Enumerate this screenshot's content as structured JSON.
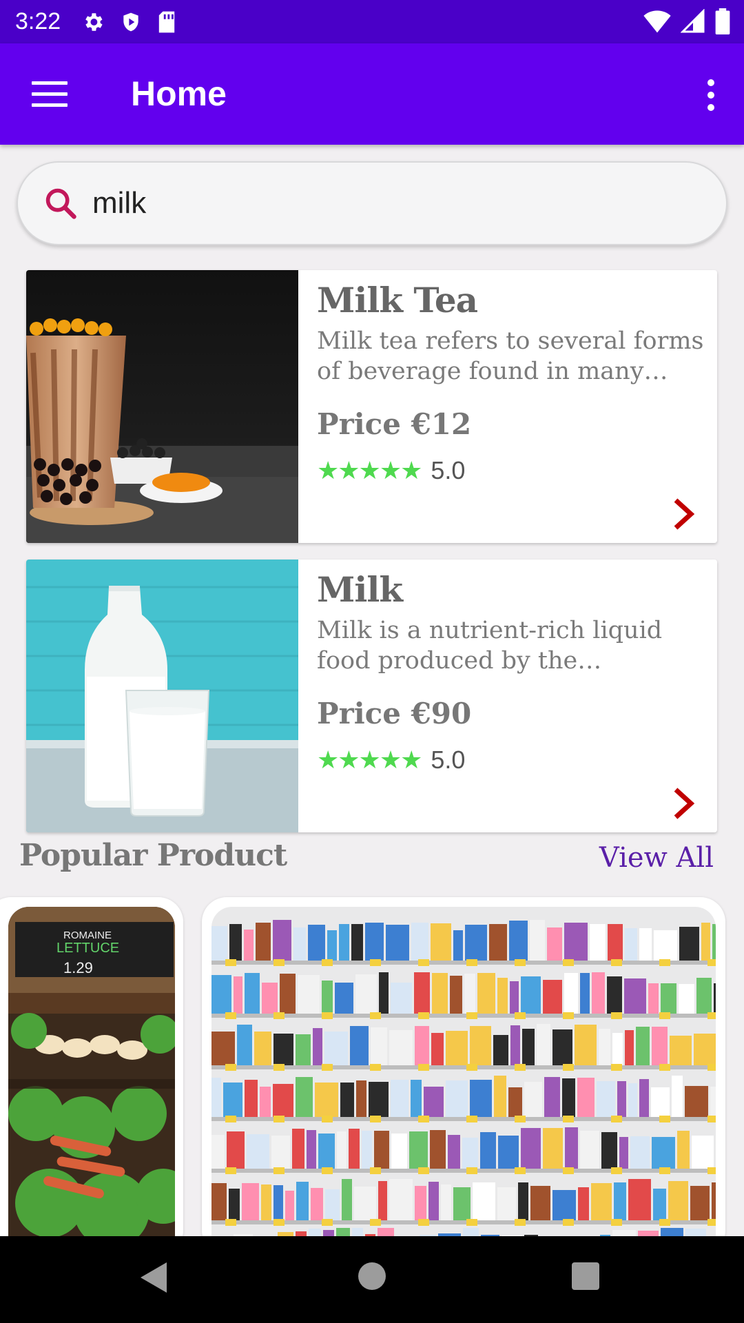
{
  "status_bar": {
    "time": "3:22",
    "icons_left": [
      "settings-icon",
      "shield-icon",
      "sd-card-icon"
    ],
    "icons_right": [
      "wifi-icon",
      "signal-icon",
      "battery-icon"
    ]
  },
  "app_bar": {
    "title": "Home",
    "color": "#6200ee"
  },
  "search": {
    "value": "milk",
    "placeholder": ""
  },
  "results": [
    {
      "title": "Milk Tea",
      "description": "Milk tea refers to several forms of beverage found in many cult…",
      "price": "Price €12",
      "stars": "★★★★★",
      "rating": "5.0"
    },
    {
      "title": "Milk",
      "description": "Milk is a nutrient-rich liquid food produced by the mammar…",
      "price": "Price €90",
      "stars": "★★★★★",
      "rating": "5.0"
    }
  ],
  "popular": {
    "title": "Popular Product",
    "view_all": "View All",
    "sign_text": [
      "ROMAINE",
      "LETTUCE",
      "1.29"
    ]
  },
  "colors": {
    "accent": "#6200ee",
    "status_bar": "#4a00c8",
    "star": "#4fd94f",
    "chevron": "#c00000",
    "view_all": "#5a1fa8"
  }
}
